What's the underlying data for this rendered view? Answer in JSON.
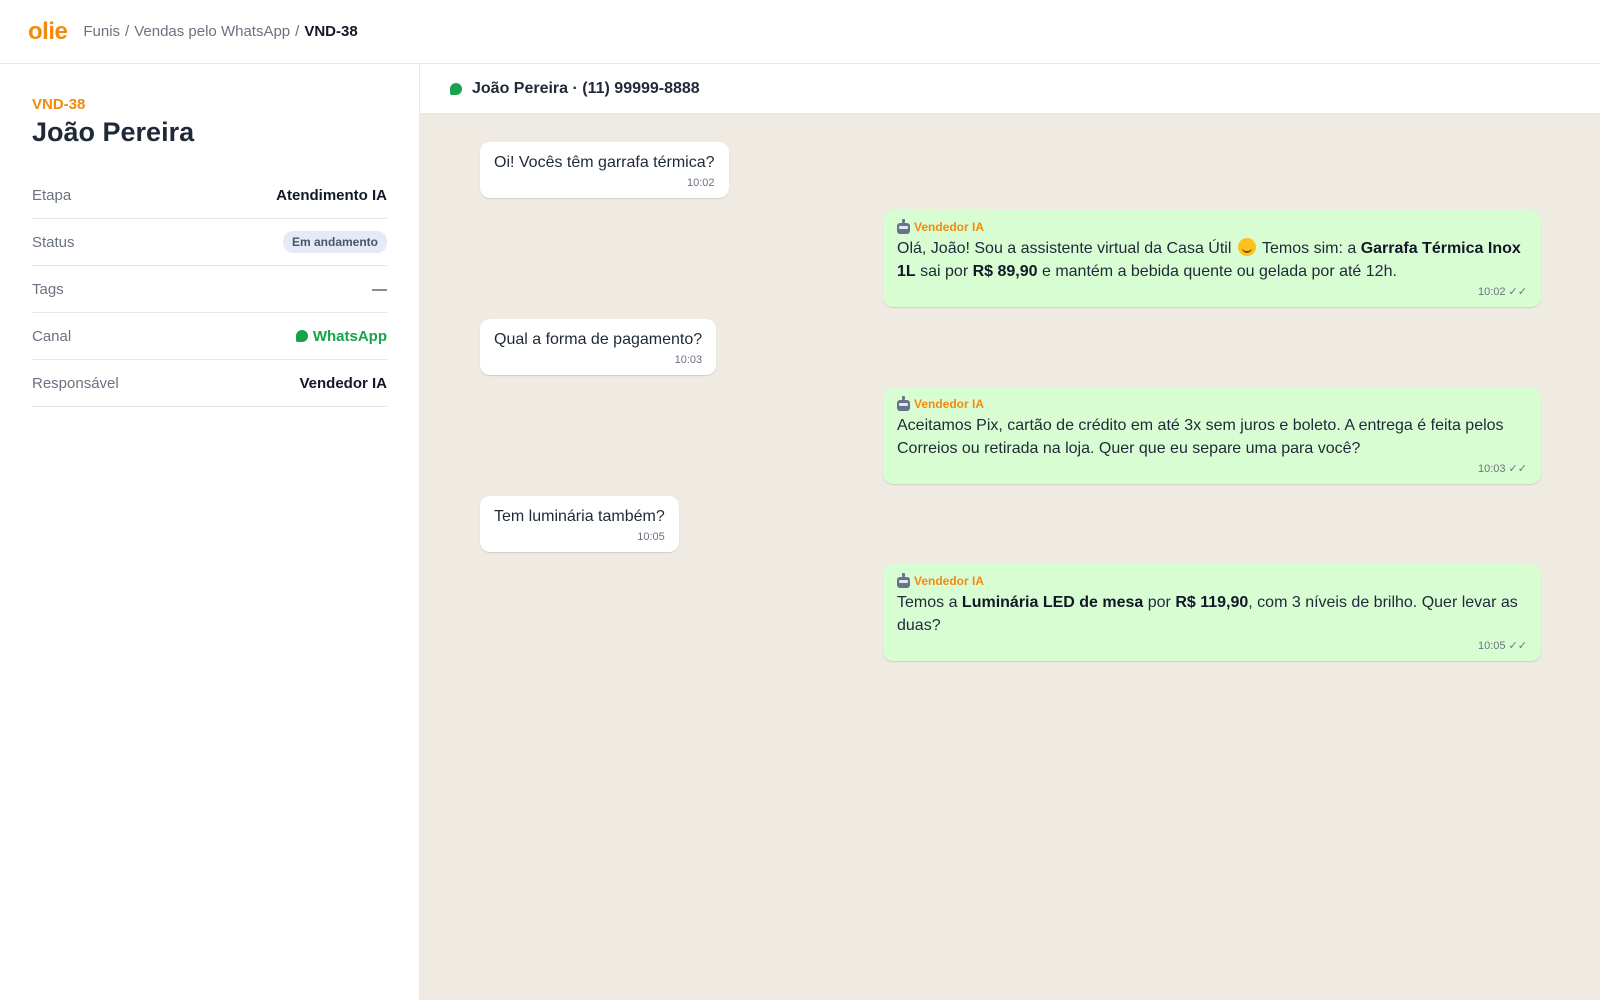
{
  "header": {
    "logo": "olie",
    "breadcrumb": [
      "Funis",
      "Vendas pelo WhatsApp",
      "VND-38"
    ],
    "separator": "/"
  },
  "sidebar": {
    "ticket_id": "VND-38",
    "contact_name": "João Pereira",
    "fields": [
      {
        "key": "Etapa",
        "value": "Atendimento IA"
      },
      {
        "key": "Status",
        "value": "Em andamento"
      },
      {
        "key": "Tags",
        "value": "—"
      },
      {
        "key": "Canal",
        "value": "WhatsApp"
      },
      {
        "key": "Responsável",
        "value": "Vendedor IA"
      }
    ]
  },
  "chat": {
    "header": "João Pereira · (11) 99999-8888",
    "messages": [
      {
        "dir": "in",
        "text": "Oi! Vocês têm garrafa térmica?",
        "time": "10:02"
      },
      {
        "dir": "out",
        "sender": "Vendedor IA",
        "parts": [
          "Olá, João! Sou a assistente virtual da Casa Útil ",
          " Temos sim: a ",
          "Garrafa Térmica Inox 1L",
          " sai por ",
          "R$ 89,90",
          " e mantém a bebida quente ou gelada por até 12h."
        ],
        "time": "10:02 ✓✓"
      },
      {
        "dir": "in",
        "text": "Qual a forma de pagamento?",
        "time": "10:03"
      },
      {
        "dir": "out",
        "sender": "Vendedor IA",
        "text": "Aceitamos Pix, cartão de crédito em até 3x sem juros e boleto. A entrega é feita pelos Correios ou retirada na loja. Quer que eu separe uma para você?",
        "time": "10:03 ✓✓"
      },
      {
        "dir": "in",
        "text": "Tem luminária também?",
        "time": "10:05"
      },
      {
        "dir": "out",
        "sender": "Vendedor IA",
        "parts": [
          "Temos a ",
          "Luminária LED de mesa",
          " por ",
          "R$ 119,90",
          ", com 3 níveis de brilho. Quer levar as duas?"
        ],
        "time": "10:05 ✓✓"
      }
    ]
  },
  "colors": {
    "brand": "#f38a0c",
    "whatsapp": "#16a34a",
    "chat_bg": "#efeae2",
    "outgoing_bubble": "#d9fdd3"
  }
}
